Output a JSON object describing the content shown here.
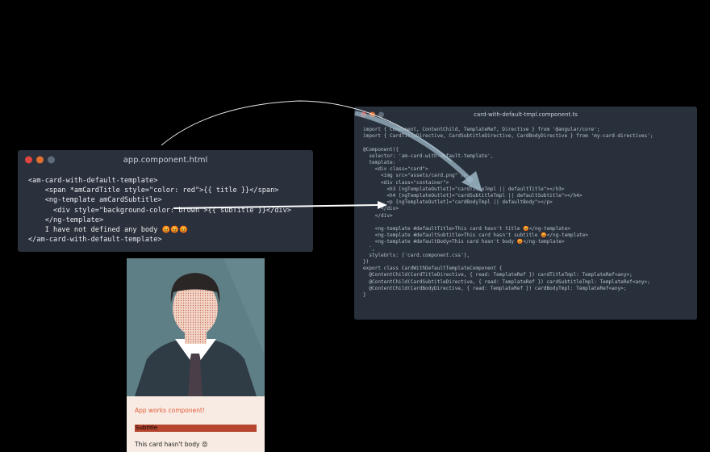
{
  "window_left": {
    "title": "app.component.html",
    "lines": [
      "<am-card-with-default-template>",
      "    <span *amCardTitle style=\"color: red\">{{ title }}</span>",
      "    <ng-template amCardSubtitle>",
      "      <div style=\"background-color: brown\">{{ subTitle }}</div>",
      "    </ng-template>",
      "    I have not defined any body 😡😡😡",
      "</am-card-with-default-template>"
    ]
  },
  "window_right": {
    "title": "card-with-default-tmpl.component.ts",
    "lines": [
      "import { Component, ContentChild, TemplateRef, Directive } from '@angular/core';",
      "import { CardTitleDirective, CardSubtitleDirective, CardBodyDirective } from 'my-card-directives';",
      "",
      "@Component({",
      "  selector: 'am-card-with-default-template',",
      "  template: `",
      "    <div class=\"card\">",
      "      <img src=\"assets/card.png\" />",
      "      <div class=\"container\">",
      "        <h3 [ngTemplateOutlet]=\"cardTitleTmpl || defaultTitle\"></h3>",
      "        <h4 [ngTemplateOutlet]=\"cardSubtitleTmpl || defaultSubtitle\"></h4>",
      "        <p [ngTemplateOutlet]=\"cardBodyTmpl || defaultBody\"></p>",
      "      </div>",
      "    </div>",
      "",
      "    <ng-template #defaultTitle>This card hasn't title 😡</ng-template>",
      "    <ng-template #defaultSubtitle>This card hasn't subtitle 😡</ng-template>",
      "    <ng-template #defaultBody>This card hasn't body 😡</ng-template>",
      "  `,",
      "  styleUrls: ['card.component.css'],",
      "})",
      "export class CardWithDefaultTemplateComponent {",
      "  @ContentChild(CardTitleDirective, { read: TemplateRef }) cardTitleTmpl: TemplateRef<any>;",
      "  @ContentChild(CardSubtitleDirective, { read: TemplateRef }) cardSubtitleTmpl: TemplateRef<any>;",
      "  @ContentChild(CardBodyDirective, { read: TemplateRef }) cardBodyTmpl: TemplateRef<any>;",
      "}"
    ]
  },
  "card": {
    "title": "App works component!",
    "subtitle": "Subtitle",
    "body": "This card hasn't body 😡"
  },
  "colors": {
    "dot_red": "#e0443e",
    "dot_orange": "#de6f2e",
    "dot_gray": "#5e6b78",
    "card_bg": "#f8ebe3",
    "subtitle_bg": "#b5452e"
  },
  "icons": [
    "close-dot",
    "minimize-dot",
    "maximize-dot",
    "avatar-illustration",
    "arrow-connector"
  ]
}
